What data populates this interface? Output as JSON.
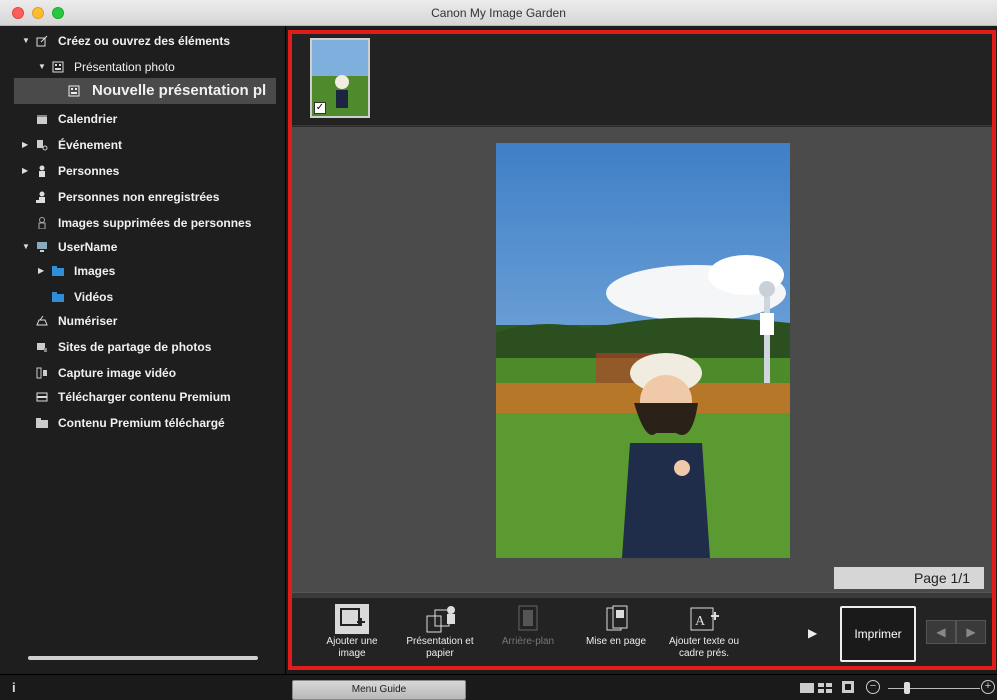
{
  "window": {
    "title": "Canon My Image Garden"
  },
  "sidebar": {
    "items": [
      {
        "label": "Créez ou ouvrez des éléments",
        "icon": "create-icon",
        "arrow": "▼"
      },
      {
        "label": "Présentation photo",
        "icon": "layout-icon",
        "arrow": "▼"
      },
      {
        "label": "Nouvelle présentation pl",
        "icon": "layout-icon",
        "arrow": ""
      },
      {
        "label": "Calendrier",
        "icon": "calendar-icon",
        "arrow": ""
      },
      {
        "label": "Événement",
        "icon": "event-icon",
        "arrow": "▶"
      },
      {
        "label": "Personnes",
        "icon": "person-icon",
        "arrow": "▶"
      },
      {
        "label": "Personnes non enregistrées",
        "icon": "person-unregistered-icon",
        "arrow": ""
      },
      {
        "label": "Images supprimées de personnes",
        "icon": "person-outline-icon",
        "arrow": ""
      },
      {
        "label": "UserName",
        "icon": "computer-icon",
        "arrow": "▼"
      },
      {
        "label": "Images",
        "icon": "folder-icon",
        "arrow": "▶"
      },
      {
        "label": "Vidéos",
        "icon": "folder-icon",
        "arrow": ""
      },
      {
        "label": "Numériser",
        "icon": "scan-icon",
        "arrow": ""
      },
      {
        "label": "Sites de partage de photos",
        "icon": "share-icon",
        "arrow": ""
      },
      {
        "label": "Capture image vidéo",
        "icon": "video-capture-icon",
        "arrow": ""
      },
      {
        "label": "Télécharger contenu Premium",
        "icon": "download-icon",
        "arrow": ""
      },
      {
        "label": "Contenu Premium téléchargé",
        "icon": "folder-icon",
        "arrow": ""
      }
    ]
  },
  "preview": {
    "page_label": "Page 1/1"
  },
  "toolbar": {
    "add_image": "Ajouter une image",
    "layout_paper": "Présentation et papier",
    "background": "Arrière-plan",
    "page_layout": "Mise en page",
    "add_text": "Ajouter texte ou cadre prés.",
    "print": "Imprimer"
  },
  "statusbar": {
    "menu_guide": "Menu Guide",
    "info": "i",
    "zoom_minus": "−",
    "zoom_plus": "+"
  },
  "colors": {
    "accent_frame": "#e21b1b"
  }
}
